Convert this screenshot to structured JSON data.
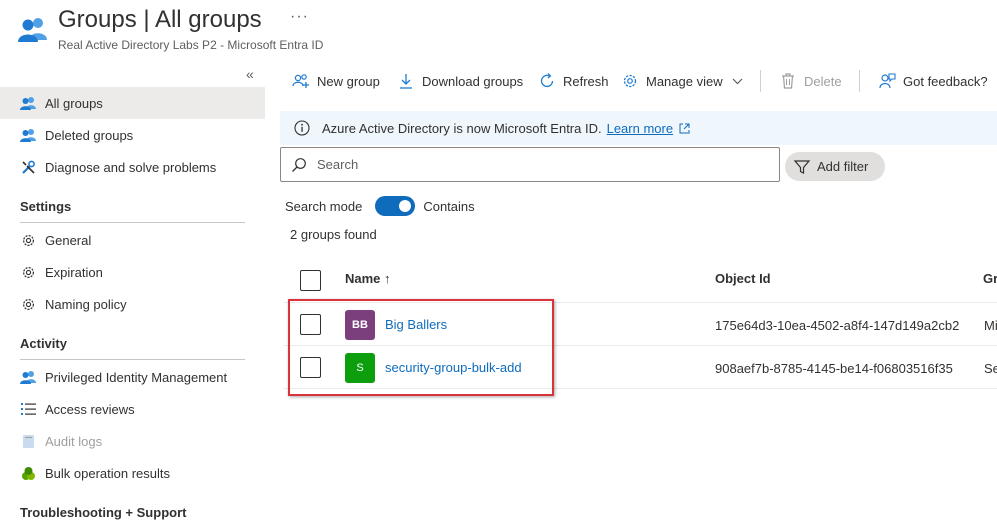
{
  "header": {
    "title": "Groups | All groups",
    "more": "···",
    "subtitle": "Real Active Directory Labs P2 - Microsoft Entra ID",
    "icon": "groups-icon"
  },
  "sidebar": {
    "collapse": "«",
    "items": [
      {
        "label": "All groups",
        "icon": "groups-icon"
      },
      {
        "label": "Deleted groups",
        "icon": "groups-icon"
      },
      {
        "label": "Diagnose and solve problems",
        "icon": "wrench-icon"
      }
    ],
    "sections": [
      {
        "title": "Settings",
        "items": [
          {
            "label": "General",
            "icon": "gear-icon"
          },
          {
            "label": "Expiration",
            "icon": "gear-icon"
          },
          {
            "label": "Naming policy",
            "icon": "gear-icon"
          }
        ]
      },
      {
        "title": "Activity",
        "items": [
          {
            "label": "Privileged Identity Management",
            "icon": "pim-icon"
          },
          {
            "label": "Access reviews",
            "icon": "list-icon"
          },
          {
            "label": "Audit logs",
            "icon": "book-icon"
          },
          {
            "label": "Bulk operation results",
            "icon": "bulk-icon"
          }
        ]
      },
      {
        "title": "Troubleshooting + Support",
        "items": []
      }
    ]
  },
  "toolbar": {
    "new_group": "New group",
    "download_groups": "Download groups",
    "refresh": "Refresh",
    "manage_view": "Manage view",
    "delete": "Delete",
    "feedback": "Got feedback?"
  },
  "banner": {
    "text": "Azure Active Directory is now Microsoft Entra ID.",
    "link": "Learn more"
  },
  "search": {
    "placeholder": "Search",
    "value": "",
    "add_filter": "Add filter",
    "mode_label": "Search mode",
    "mode_value": "Contains",
    "mode_on": true
  },
  "results_count": "2 groups found",
  "table": {
    "columns": {
      "name": "Name ↑",
      "object_id": "Object Id",
      "group_type": "Gr"
    },
    "rows": [
      {
        "initials": "BB",
        "name": "Big Ballers",
        "object_id": "175e64d3-10ea-4502-a8f4-147d149a2cb2",
        "group_type": "Mi",
        "avatar_color": "#7b3f7e"
      },
      {
        "initials": "S",
        "name": "security-group-bulk-add",
        "object_id": "908aef7b-8785-4145-be14-f06803516f35",
        "group_type": "Se",
        "avatar_color": "#0d9e0d"
      }
    ]
  },
  "colors": {
    "accent": "#0f6cbd",
    "highlight": "#d9343b",
    "selected_nav": "#edebe9"
  }
}
